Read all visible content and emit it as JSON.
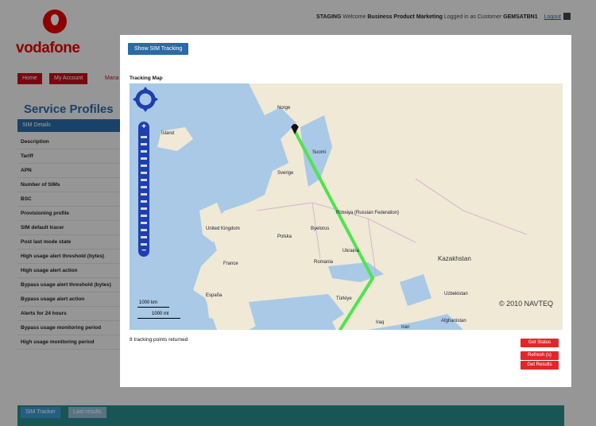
{
  "header": {
    "info_prefix": "STAGING",
    "info_welcome": "Welcome",
    "info_user": "Business Product Marketing",
    "info_logged": "Logged in as Customer",
    "info_account": "GEMSATBN1",
    "logout_label": "Logout"
  },
  "brand": {
    "logo_text": "vodafone"
  },
  "nav": {
    "home": "Home",
    "my_account": "My Account",
    "manage": "Mana"
  },
  "service_profiles": {
    "title": "Service Profiles",
    "header": "SIM Details",
    "rows": [
      "Description",
      "Tariff",
      "APN",
      "Number of SIMs",
      "BSC",
      "Provisioning profile",
      "SIM default tracer",
      "Post last mode state",
      "High usage alert threshold (bytes)",
      "High usage alert action",
      "Bypass usage alert threshold (bytes)",
      "Bypass usage alert action",
      "Alerts for 24 hours",
      "Bypass usage monitoring period",
      "High usage monitoring period"
    ]
  },
  "bottom_tabs": {
    "tab1": "SIM Tracker",
    "tab2": "Last results"
  },
  "modal": {
    "show_button": "Show SIM Tracking",
    "map_label": "Tracking Map",
    "copyright": "© 2010 NAVTEQ",
    "scale_km": "1000 km",
    "scale_mi": "1000 mi",
    "status_text": "8 tracking points returned",
    "buttons": [
      "Get Status",
      "Refresh (s)",
      "Get Results"
    ],
    "map_labels": [
      {
        "text": "Norge",
        "cls": ""
      },
      {
        "text": "Ísland",
        "cls": ""
      },
      {
        "text": "Sverige",
        "cls": ""
      },
      {
        "text": "Suomi",
        "cls": ""
      },
      {
        "text": "United Kingdom",
        "cls": ""
      },
      {
        "text": "Polska",
        "cls": ""
      },
      {
        "text": "Byelorus",
        "cls": ""
      },
      {
        "text": "Ukraina",
        "cls": ""
      },
      {
        "text": "France",
        "cls": ""
      },
      {
        "text": "Romania",
        "cls": ""
      },
      {
        "text": "España",
        "cls": ""
      },
      {
        "text": "Türkiye",
        "cls": ""
      },
      {
        "text": "Kazakhstan",
        "cls": "big"
      },
      {
        "text": "Uzbekistan",
        "cls": ""
      },
      {
        "text": "Iraq",
        "cls": ""
      },
      {
        "text": "Iran",
        "cls": ""
      },
      {
        "text": "Afghanistan",
        "cls": ""
      },
      {
        "text": "Rossiya (Russian Federation)",
        "cls": ""
      }
    ]
  },
  "colors": {
    "brand_red": "#e60000",
    "link_blue": "#2a6aa8",
    "track_green": "#4ee44e",
    "button_red": "#e3262a"
  }
}
